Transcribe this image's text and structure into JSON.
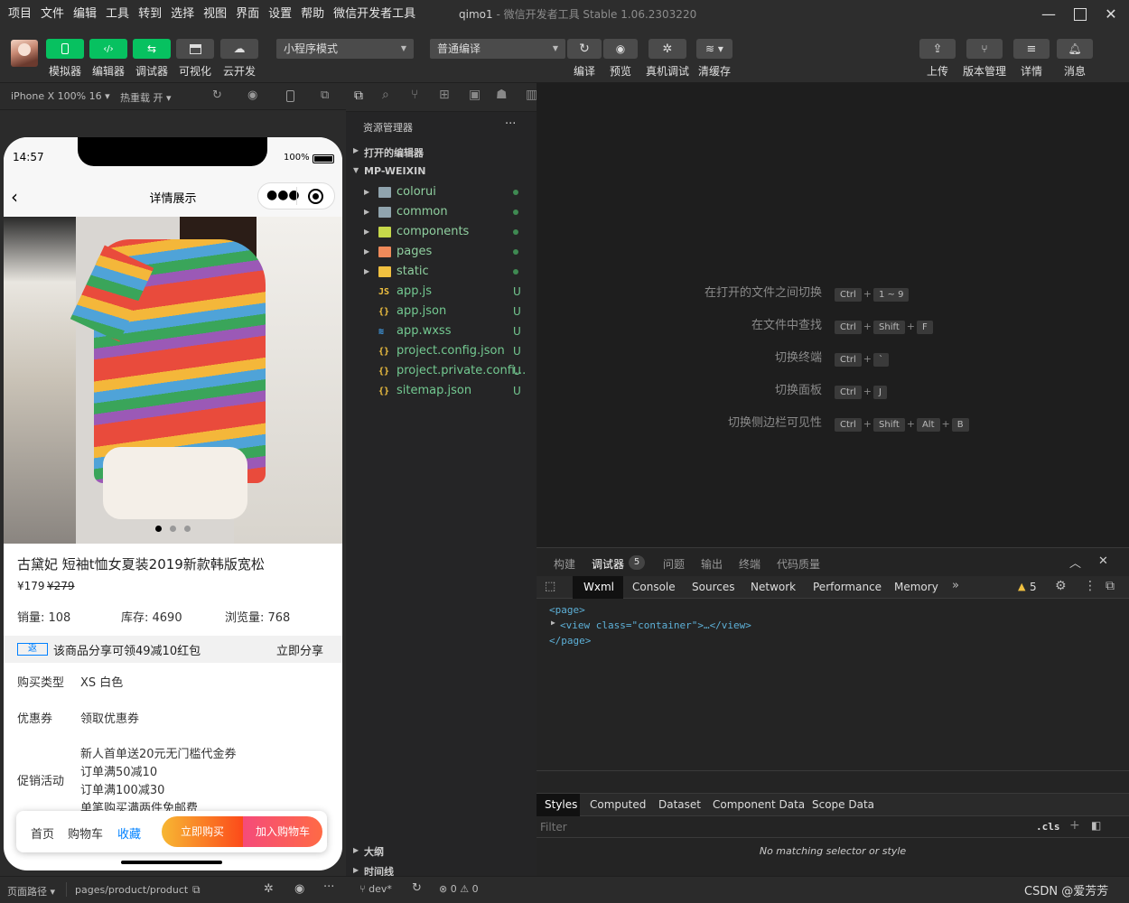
{
  "menubar": [
    "项目",
    "文件",
    "编辑",
    "工具",
    "转到",
    "选择",
    "视图",
    "界面",
    "设置",
    "帮助",
    "微信开发者工具"
  ],
  "window": {
    "name": "qimo1",
    "sep": " - ",
    "app": "微信开发者工具 Stable 1.06.2303220"
  },
  "toolbar": {
    "left": [
      {
        "label": "模拟器",
        "icon": "phone-icon"
      },
      {
        "label": "编辑器",
        "icon": "code-icon"
      },
      {
        "label": "调试器",
        "icon": "debug-icon"
      },
      {
        "label": "可视化",
        "icon": "layout-icon"
      },
      {
        "label": "云开发",
        "icon": "cloud-icon"
      }
    ],
    "mode": "小程序模式",
    "compile_mode": "普通编译",
    "actions": [
      {
        "label": "编译",
        "icon": "refresh-icon"
      },
      {
        "label": "预览",
        "icon": "eye-icon"
      },
      {
        "label": "真机调试",
        "icon": "bug-icon"
      },
      {
        "label": "清缓存",
        "icon": "layers-icon"
      }
    ],
    "right": [
      {
        "label": "上传",
        "icon": "upload-icon"
      },
      {
        "label": "版本管理",
        "icon": "branch-icon"
      },
      {
        "label": "详情",
        "icon": "menu-icon"
      },
      {
        "label": "消息",
        "icon": "bell-icon"
      }
    ]
  },
  "simbar": {
    "device": "iPhone X 100% 16",
    "hot_reload": "热重载 开"
  },
  "phone": {
    "time": "14:57",
    "battery": "100%",
    "nav_title": "详情展示",
    "product_title": "古黛妃 短袖t恤女夏装2019新款韩版宽松",
    "price": "¥179",
    "old_price": "¥279",
    "sales": "销量: 108",
    "stock": "库存: 4690",
    "views": "浏览量: 768",
    "share_tag": "返",
    "share_text": "该商品分享可领49减10红包",
    "share_btn": "立即分享",
    "rows": [
      {
        "label": "购买类型",
        "value": "XS 白色"
      },
      {
        "label": "优惠券",
        "value": "领取优惠券"
      }
    ],
    "promo_label": "促销活动",
    "promos": [
      "新人首单送20元无门槛代金券",
      "订单满50减10",
      "订单满100减30",
      "单笔购买满两件免邮费"
    ],
    "bottom": {
      "home": "首页",
      "cart": "购物车",
      "fav": "收藏",
      "buy": "立即购买",
      "add": "加入购物车"
    }
  },
  "explorer": {
    "title": "资源管理器",
    "open_editors": "打开的编辑器",
    "project": "MP-WEIXIN",
    "items": [
      {
        "name": "colorui",
        "type": "folder",
        "status": "dot"
      },
      {
        "name": "common",
        "type": "folder",
        "status": "dot"
      },
      {
        "name": "components",
        "type": "folder",
        "status": "dot"
      },
      {
        "name": "pages",
        "type": "folder",
        "status": "dot"
      },
      {
        "name": "static",
        "type": "folder",
        "status": "dot"
      },
      {
        "name": "app.js",
        "type": "js",
        "status": "U"
      },
      {
        "name": "app.json",
        "type": "json",
        "status": "U"
      },
      {
        "name": "app.wxss",
        "type": "css",
        "status": "U"
      },
      {
        "name": "project.config.json",
        "type": "json",
        "status": "U"
      },
      {
        "name": "project.private.confi...",
        "type": "json",
        "status": "U"
      },
      {
        "name": "sitemap.json",
        "type": "json",
        "status": "U"
      }
    ],
    "outline": "大纲",
    "timeline": "时间线"
  },
  "editor": {
    "hints": [
      {
        "text": "在打开的文件之间切换",
        "keys": [
          "Ctrl",
          "1 ~ 9"
        ]
      },
      {
        "text": "在文件中查找",
        "keys": [
          "Ctrl",
          "Shift",
          "F"
        ]
      },
      {
        "text": "切换终端",
        "keys": [
          "Ctrl",
          "`"
        ]
      },
      {
        "text": "切换面板",
        "keys": [
          "Ctrl",
          "J"
        ]
      },
      {
        "text": "切换侧边栏可见性",
        "keys": [
          "Ctrl",
          "Shift",
          "Alt",
          "B"
        ]
      }
    ]
  },
  "devtools": {
    "panel_tabs": [
      "构建",
      "调试器",
      "问题",
      "输出",
      "终端",
      "代码质量"
    ],
    "debugger_badge": "5",
    "tabs": [
      "Wxml",
      "Console",
      "Sources",
      "Network",
      "Performance",
      "Memory"
    ],
    "warnings": "5",
    "code": [
      "<page>",
      "<view class=\"container\">…</view>",
      "</page>"
    ],
    "style_tabs": [
      "Styles",
      "Computed",
      "Dataset",
      "Component Data",
      "Scope Data"
    ],
    "filter_placeholder": "Filter",
    "cls": ".cls",
    "no_match": "No matching selector or style"
  },
  "statusbar": {
    "path_label": "页面路径",
    "path": "pages/product/product",
    "branch": "dev*",
    "errors": "0",
    "warnings": "0",
    "watermark": "CSDN @爱芳芳"
  },
  "colors": {
    "accent": "#07c160",
    "buy_start": "#f7b733",
    "buy_end": "#fc4a1a",
    "add_start": "#f54b7a",
    "add_end": "#ff6a45"
  }
}
